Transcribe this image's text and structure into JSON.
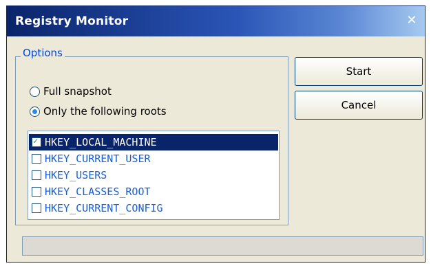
{
  "window": {
    "title": "Registry Monitor",
    "close_glyph": "✕"
  },
  "options": {
    "legend": "Options",
    "radios": [
      {
        "label": "Full snapshot",
        "checked": false
      },
      {
        "label": "Only the following roots",
        "checked": true
      }
    ],
    "roots": [
      {
        "label": "HKEY_LOCAL_MACHINE",
        "checked": true,
        "selected": true
      },
      {
        "label": "HKEY_CURRENT_USER",
        "checked": false,
        "selected": false
      },
      {
        "label": "HKEY_USERS",
        "checked": false,
        "selected": false
      },
      {
        "label": "HKEY_CLASSES_ROOT",
        "checked": false,
        "selected": false
      },
      {
        "label": "HKEY_CURRENT_CONFIG",
        "checked": false,
        "selected": false
      }
    ]
  },
  "buttons": {
    "start_label": "Start",
    "cancel_label": "Cancel"
  },
  "colors": {
    "title_bar": "#0a246a",
    "selection": "#0a246a",
    "link_text": "#1a5fd1"
  },
  "progress": {
    "fraction": 0
  }
}
